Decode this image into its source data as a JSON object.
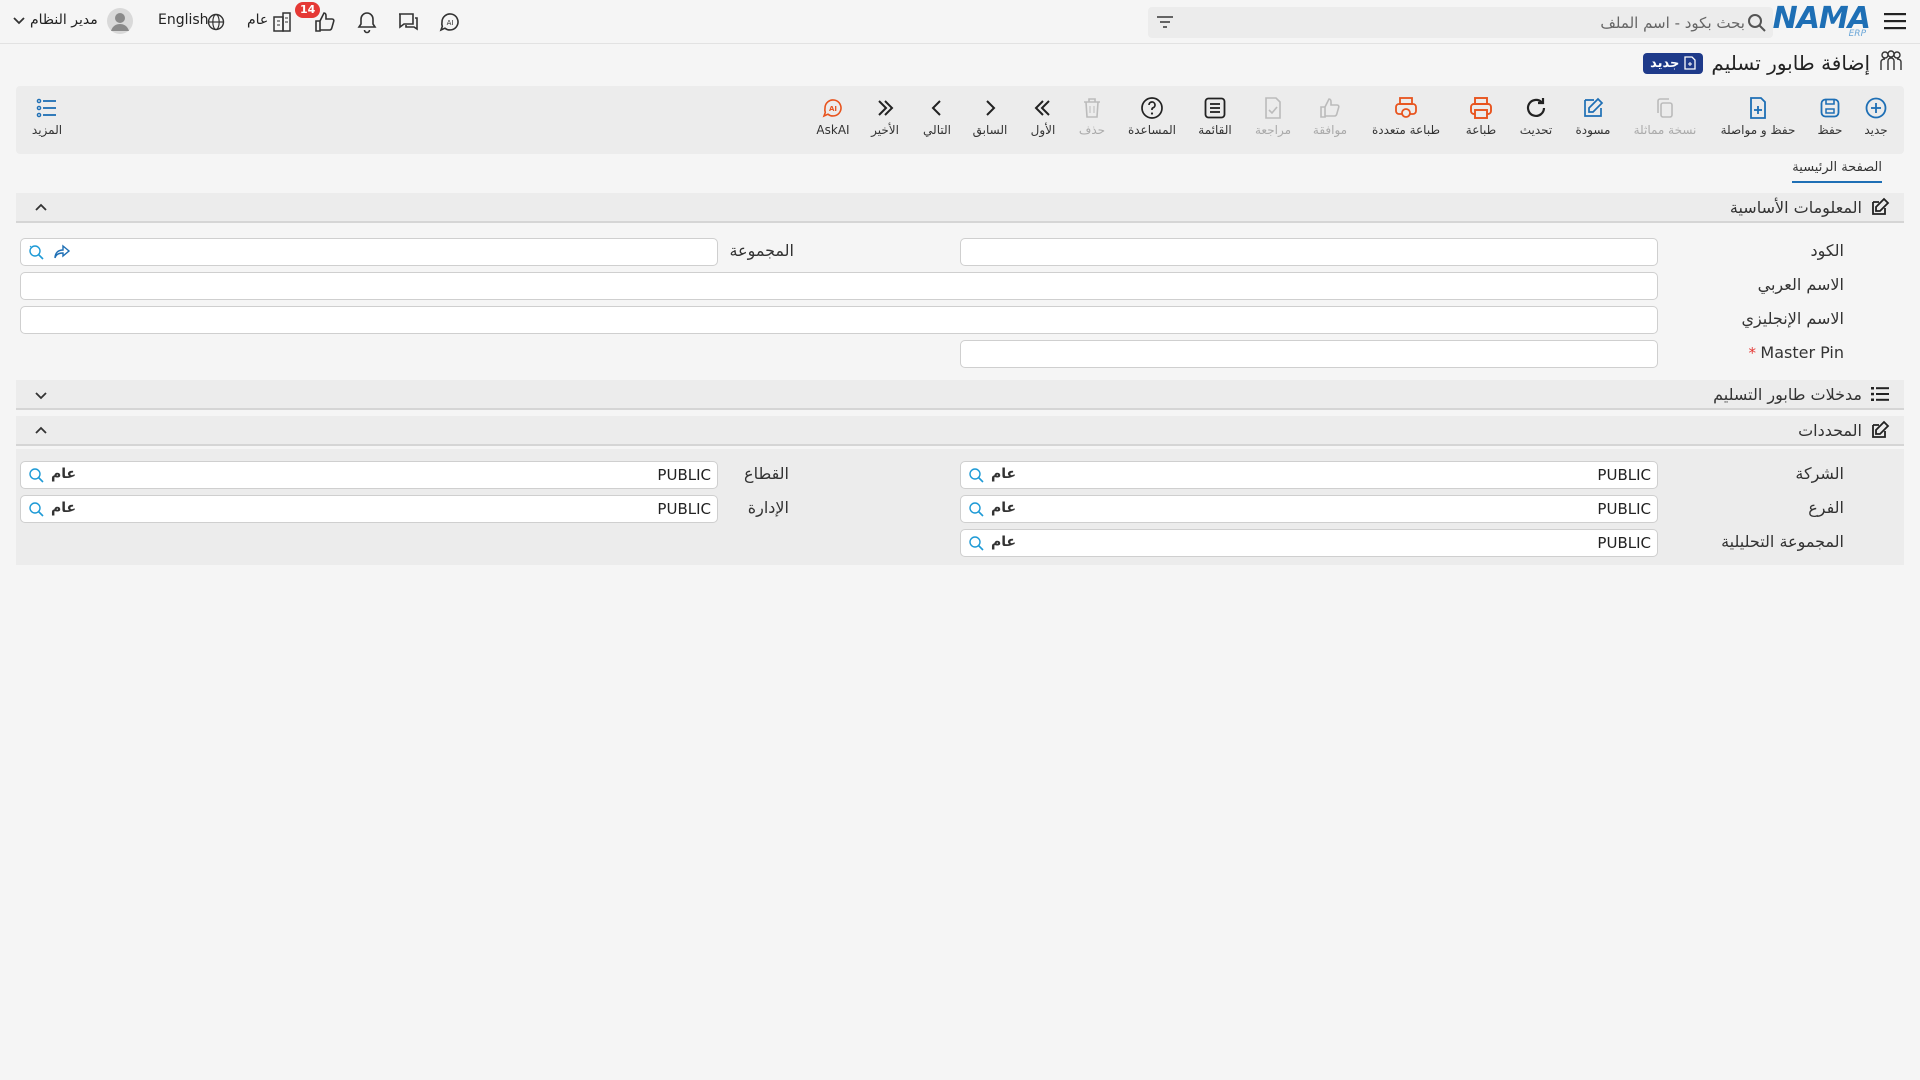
{
  "app": {
    "logo": "NAMA",
    "logo_sub": "ERP"
  },
  "topbar": {
    "search_placeholder": "بحث بكود - اسم الملف",
    "badge_count": "14",
    "scope_label": "عام",
    "language": "English",
    "user_name": "مدير النظام"
  },
  "page": {
    "title": "إضافة طابور تسليم",
    "status": "جديد"
  },
  "toolbar": {
    "new": "جديد",
    "save": "حفظ",
    "save_continue": "حفظ و مواصلة",
    "duplicate": "نسخة مماثلة",
    "draft": "مسودة",
    "refresh": "تحديث",
    "print": "طباعة",
    "multi_print": "طباعة متعددة",
    "approve": "موافقة",
    "review": "مراجعة",
    "list": "القائمة",
    "help": "المساعدة",
    "delete": "حذف",
    "first": "الأول",
    "previous": "السابق",
    "next": "التالي",
    "last": "الأخير",
    "askai": "AskAI",
    "more": "المزيد"
  },
  "tabs": {
    "main": "الصفحة الرئيسية"
  },
  "basic_info": {
    "title": "المعلومات الأساسية",
    "code_label": "الكود",
    "group_label": "المجموعة",
    "arabic_name_label": "الاسم العربي",
    "english_name_label": "الاسم الإنجليزي",
    "master_pin_label": "Master Pin",
    "required_mark": "*"
  },
  "entries_section": {
    "title": "مدخلات طابور التسليم"
  },
  "dimensions": {
    "title": "المحددات",
    "company_label": "الشركة",
    "company_value": "PUBLIC",
    "company_tag": "عام",
    "sector_label": "القطاع",
    "sector_value": "PUBLIC",
    "sector_tag": "عام",
    "branch_label": "الفرع",
    "branch_value": "PUBLIC",
    "branch_tag": "عام",
    "department_label": "الإدارة",
    "department_value": "PUBLIC",
    "department_tag": "عام",
    "analysis_label": "المجموعة التحليلية",
    "analysis_value": "PUBLIC",
    "analysis_tag": "عام"
  },
  "colors": {
    "accent": "#1e6fb5",
    "orange": "#e8541e",
    "badge": "#e53935",
    "status_bg": "#1e3a8a"
  }
}
